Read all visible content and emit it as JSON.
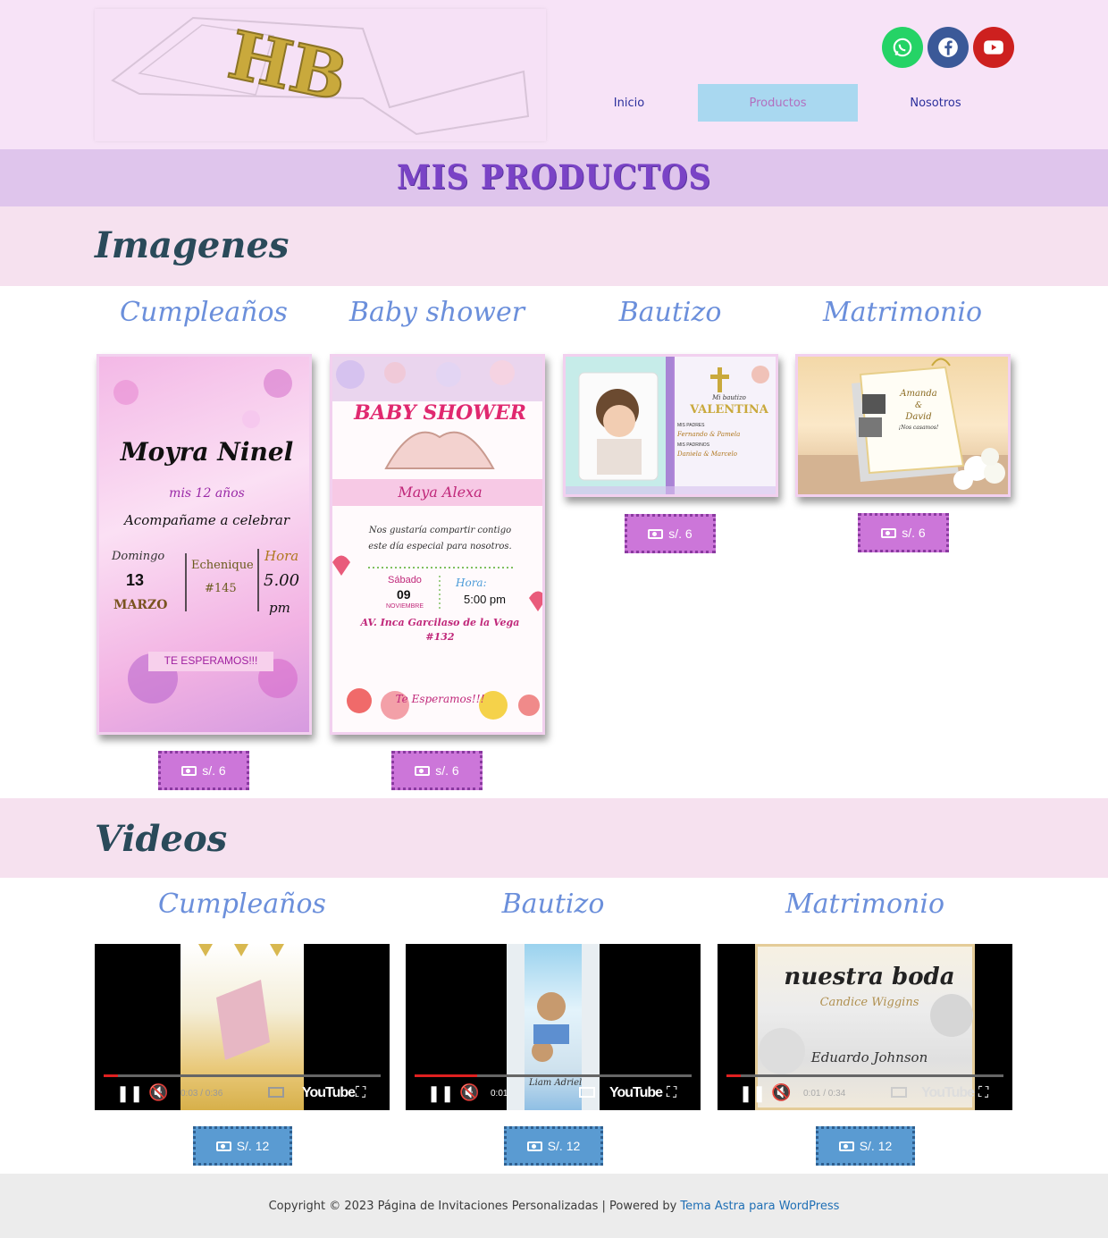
{
  "header": {
    "logo_text": "HB",
    "social": [
      {
        "name": "whatsapp-icon",
        "color": "#25d366"
      },
      {
        "name": "facebook-icon",
        "color": "#3b5998"
      },
      {
        "name": "youtube-icon",
        "color": "#cd201f"
      }
    ],
    "nav": [
      {
        "label": "Inicio",
        "active": false
      },
      {
        "label": "Productos",
        "active": true
      },
      {
        "label": "Nosotros",
        "active": false
      }
    ]
  },
  "page_title": "MIS PRODUCTOS",
  "images_section": {
    "title": "Imagenes",
    "categories": [
      {
        "title": "Cumpleaños",
        "price": "s/. 6",
        "card": {
          "name": "Moyra Ninel",
          "age": "mis 12 años",
          "invite": "Acompañame a celebrar",
          "day_label": "Domingo",
          "day": "13",
          "month": "MARZO",
          "place": "Echenique",
          "number": "#145",
          "hour_label": "Hora",
          "hour": "5.00",
          "pm": "pm",
          "footer": "TE ESPERAMOS!!!"
        }
      },
      {
        "title": "Baby shower",
        "price": "s/. 6",
        "card": {
          "heading": "BABY SHOWER",
          "name": "Maya Alexa",
          "text": "Nos gustaría compartir contigo este día especial para nosotros.",
          "day_label": "Sábado",
          "day": "09",
          "month": "NOVIEMBRE",
          "hour_label": "Hora:",
          "hour": "5:00 pm",
          "address": "AV. Inca Garcilaso de la Vega #132",
          "footer": "Te Esperamos!!!"
        }
      },
      {
        "title": "Bautizo",
        "price": "s/. 6",
        "card": {
          "line1": "Mi bautizo",
          "name": "VALENTINA",
          "parents_label": "MIS PADRES",
          "parents": "Fernando & Pamela",
          "godparents_label": "MIS PADRINOS",
          "godparents": "Daniela & Marcelo"
        }
      },
      {
        "title": "Matrimonio",
        "price": "s/. 6",
        "card": {
          "bride": "Amanda",
          "amp": "&",
          "groom": "David",
          "line": "¡Nos casamos!"
        }
      }
    ]
  },
  "videos_section": {
    "title": "Videos",
    "items": [
      {
        "title": "Cumpleaños",
        "price": "S/. 12",
        "time": "0:03 / 0:36",
        "brand": "YouTube"
      },
      {
        "title": "Bautizo",
        "price": "S/. 12",
        "time": "0:01",
        "brand": "YouTube",
        "overlay": "Liam Adriel"
      },
      {
        "title": "Matrimonio",
        "price": "S/. 12",
        "time": "0:01 / 0:34",
        "brand": "YouTube",
        "overlay1": "nuestra boda",
        "overlay2": "Candice Wiggins",
        "overlay3": "Eduardo Johnson"
      }
    ]
  },
  "footer": {
    "text": "Copyright © 2023 Página de Invitaciones Personalizadas | Powered by",
    "link": "Tema Astra para WordPress"
  }
}
